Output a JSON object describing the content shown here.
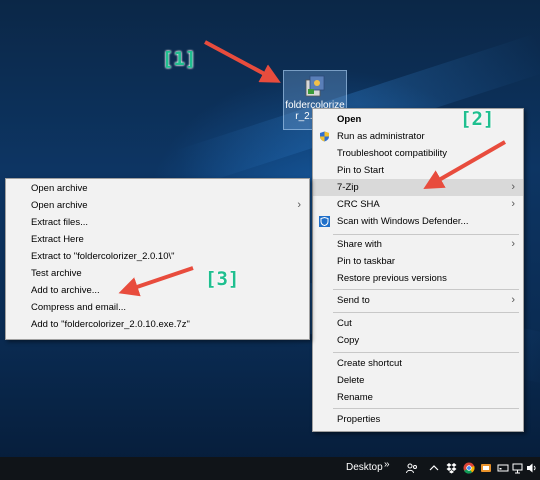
{
  "desktop": {
    "icon_label": "foldercolorize r_2.0.1..."
  },
  "context_menu": {
    "items": [
      {
        "label": "Open",
        "bold": true
      },
      {
        "label": "Run as administrator"
      },
      {
        "label": "Troubleshoot compatibility"
      },
      {
        "label": "Pin to Start"
      },
      {
        "label": "7-Zip",
        "submenu": true
      },
      {
        "label": "CRC SHA",
        "submenu": true
      },
      {
        "label": "Scan with Windows Defender..."
      },
      {
        "label": "Share with",
        "submenu": true
      },
      {
        "label": "Pin to taskbar"
      },
      {
        "label": "Restore previous versions"
      },
      {
        "label": "Send to",
        "submenu": true
      },
      {
        "label": "Cut"
      },
      {
        "label": "Copy"
      },
      {
        "label": "Create shortcut"
      },
      {
        "label": "Delete"
      },
      {
        "label": "Rename"
      },
      {
        "label": "Properties"
      }
    ]
  },
  "submenu_7zip": {
    "items": [
      {
        "label": "Open archive"
      },
      {
        "label": "Open archive",
        "submenu": true
      },
      {
        "label": "Extract files..."
      },
      {
        "label": "Extract Here"
      },
      {
        "label": "Extract to \"foldercolorizer_2.0.10\\\""
      },
      {
        "label": "Test archive"
      },
      {
        "label": "Add to archive..."
      },
      {
        "label": "Compress and email..."
      },
      {
        "label": "Add to \"foldercolorizer_2.0.10.exe.7z\""
      }
    ]
  },
  "callouts": [
    "[1]",
    "[2]",
    "[3]"
  ],
  "taskbar": {
    "desktop_label": "Desktop",
    "chevron": "»"
  },
  "colors": {
    "callout": "#1fbf8f",
    "arrow": "#e84c3d",
    "menu_bg": "#f2f2f2",
    "highlight": "#d9d9d9"
  }
}
